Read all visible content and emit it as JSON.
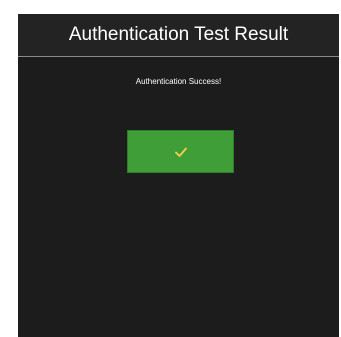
{
  "dialog": {
    "title": "Authentication Test Result",
    "message": "Authentication Success!",
    "ok_button": {
      "icon": "checkmark-icon",
      "icon_color": "#f0d24a",
      "background": "#3f9e37"
    }
  }
}
